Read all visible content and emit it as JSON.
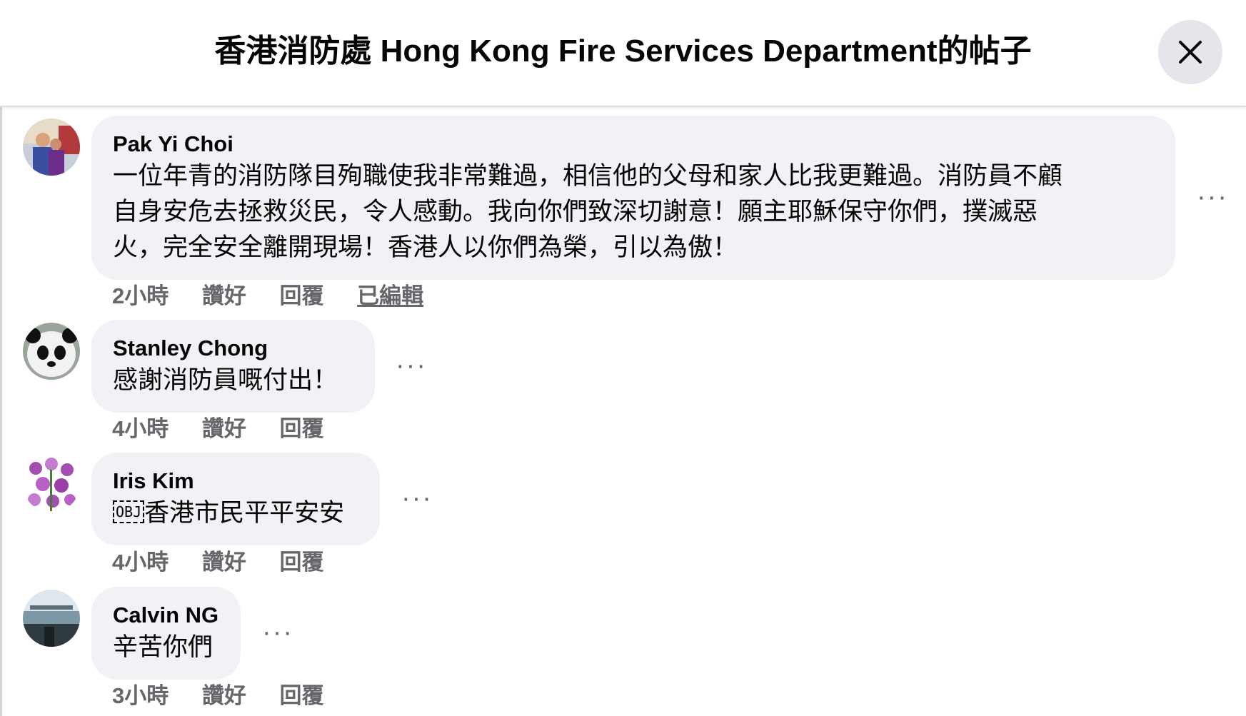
{
  "header": {
    "title": "香港消防處 Hong Kong Fire Services Department的帖子",
    "close_icon": "close-icon"
  },
  "comments": [
    {
      "author": "Pak Yi Choi",
      "text_lines": [
        "一位年青的消防隊目殉職使我非常難過，相信他的父母和家人比我更難過。消防員不顧",
        "自身安危去拯救災民，令人感動。我向你們致深切謝意！願主耶穌保守你們，撲滅惡",
        "火，完全安全離開現場！香港人以你們為榮，引以為傲！"
      ],
      "time": "2小時",
      "like": "讚好",
      "reply": "回覆",
      "edited": "已編輯",
      "more": "···"
    },
    {
      "author": "Stanley Chong",
      "text": "感謝消防員嘅付出！",
      "time": "4小時",
      "like": "讚好",
      "reply": "回覆",
      "more": "···"
    },
    {
      "author": "Iris Kim",
      "obj_glyph": "OBJ",
      "text": "香港市民平平安安",
      "time": "4小時",
      "like": "讚好",
      "reply": "回覆",
      "more": "···"
    },
    {
      "author": "Calvin NG",
      "text": "辛苦你們",
      "time": "3小時",
      "like": "讚好",
      "reply": "回覆",
      "more": "···"
    }
  ]
}
